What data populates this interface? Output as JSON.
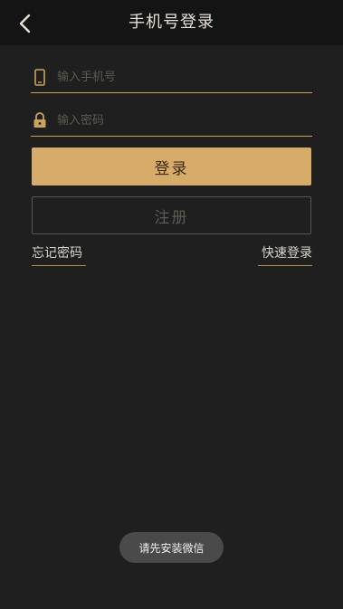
{
  "header": {
    "title": "手机号登录",
    "back_icon": "chevron-left-icon"
  },
  "form": {
    "phone_placeholder": "输入手机号",
    "phone_value": "",
    "phone_icon": "mobile-phone-icon",
    "password_placeholder": "输入密码",
    "password_value": "",
    "password_icon": "lock-icon"
  },
  "buttons": {
    "login_label": "登录",
    "register_label": "注册"
  },
  "links": {
    "forgot_password": "忘记密码",
    "quick_login": "快速登录"
  },
  "toast": {
    "message": "请先安装微信"
  },
  "colors": {
    "accent": "#d7ab6a",
    "background": "#1f1f1f",
    "header_background": "#141414"
  }
}
